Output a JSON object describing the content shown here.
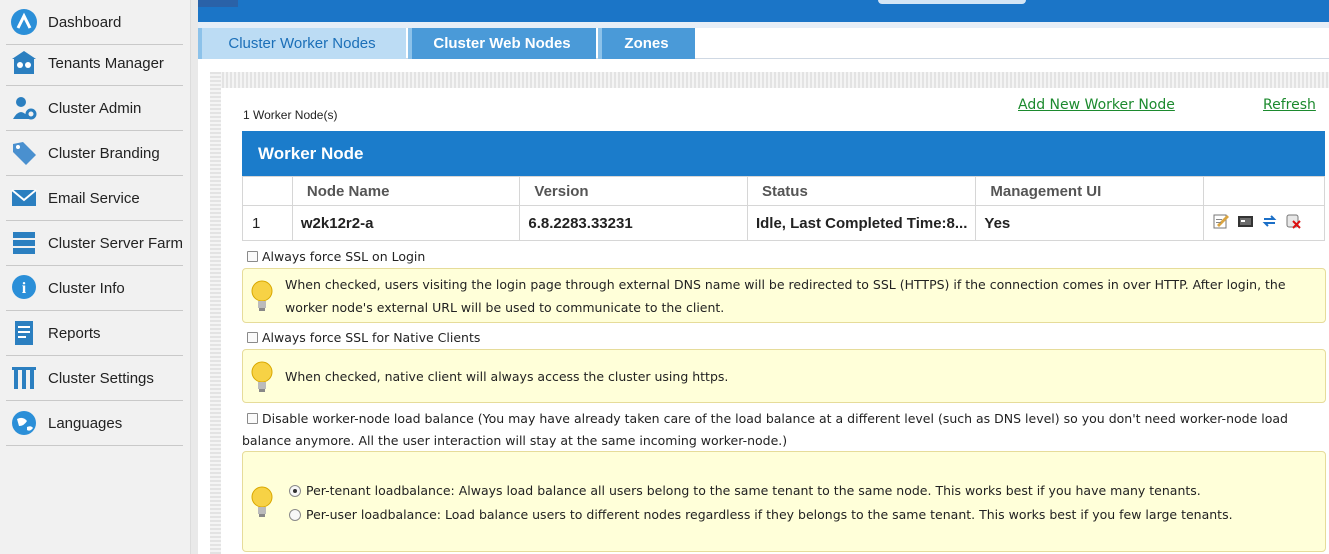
{
  "sidebar": {
    "items": [
      {
        "label": "Dashboard",
        "icon": "dashboard-icon"
      },
      {
        "label": "Tenants Manager",
        "icon": "tenants-icon"
      },
      {
        "label": "Cluster Admin",
        "icon": "cluster-admin-icon"
      },
      {
        "label": "Cluster Branding",
        "icon": "branding-tag-icon"
      },
      {
        "label": "Email Service",
        "icon": "email-icon"
      },
      {
        "label": "Cluster Server Farm",
        "icon": "server-farm-icon"
      },
      {
        "label": "Cluster Info",
        "icon": "info-icon"
      },
      {
        "label": "Reports",
        "icon": "reports-icon"
      },
      {
        "label": "Cluster Settings",
        "icon": "settings-tools-icon"
      },
      {
        "label": "Languages",
        "icon": "globe-icon"
      }
    ]
  },
  "tabs": [
    {
      "label": "Cluster Worker Nodes",
      "active": true
    },
    {
      "label": "Cluster Web Nodes",
      "active": false
    },
    {
      "label": "Zones",
      "active": false
    }
  ],
  "header": {
    "count": "1 Worker Node(s)",
    "add_link": "Add New Worker Node",
    "refresh_link": "Refresh"
  },
  "table": {
    "title": "Worker Node",
    "columns": [
      "",
      "Node Name",
      "Version",
      "Status",
      "Management UI",
      ""
    ],
    "rows": [
      {
        "num": "1",
        "node_name": "w2k12r2-a",
        "version": "6.8.2283.33231",
        "status": "Idle, Last Completed Time:8...",
        "management_ui": "Yes",
        "actions": [
          "edit-icon",
          "console-icon",
          "sync-icon",
          "delete-icon"
        ]
      }
    ]
  },
  "options": {
    "ssl_login": {
      "label": "Always force SSL on Login",
      "checked": false,
      "tip": "When checked, users visiting the login page through external DNS name will be redirected to SSL (HTTPS) if the connection comes in over HTTP. After login, the worker node's external URL will be used to communicate to the client."
    },
    "ssl_native": {
      "label": "Always force SSL for Native Clients",
      "checked": false,
      "tip": "When checked, native client will always access the cluster using https."
    },
    "disable_lb": {
      "label": "Disable worker-node load balance (You may have already taken care of the load balance at a different level (such as DNS level) so you don't need worker-node load balance anymore. All the user interaction will stay at the same incoming worker-node.)",
      "checked": false
    },
    "lb_mode": {
      "per_tenant": "Per-tenant loadbalance: Always load balance all users belong to the same tenant to the same node. This works best if you have many tenants.",
      "per_user": "Per-user loadbalance: Load balance users to different nodes regardless if they belongs to the same tenant. This works best if you few large tenants.",
      "selected": "per_tenant"
    }
  },
  "colors": {
    "accent": "#1b7ccb",
    "link": "#1c8a2e",
    "tip_bg": "#ffffd9"
  }
}
